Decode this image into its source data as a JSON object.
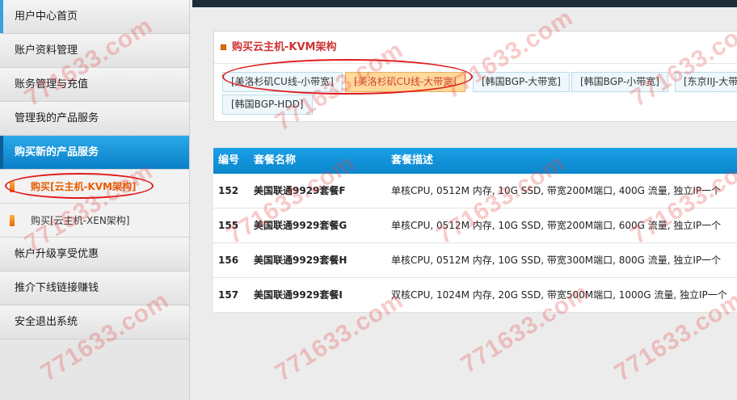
{
  "sidebar": {
    "items": [
      {
        "label": "用户中心首页"
      },
      {
        "label": "账户资料管理"
      },
      {
        "label": "账务管理与充值"
      },
      {
        "label": "管理我的产品服务"
      },
      {
        "label": "购买新的产品服务"
      }
    ],
    "sub_items": [
      {
        "label": "购买[云主机-KVM架构]"
      },
      {
        "label": "购买[云主机-XEN架构]"
      }
    ],
    "bottom_items": [
      {
        "label": "帐户升级享受优惠"
      },
      {
        "label": "推介下线链接赚钱"
      },
      {
        "label": "安全退出系统"
      }
    ]
  },
  "panel": {
    "title": "购买云主机-KVM架构",
    "tabs": [
      "[美洛杉矶CU线-小带宽]",
      "[美洛杉矶CU线-大带宽]",
      "[韩国BGP-大带宽]",
      "[韩国BGP-小带宽]",
      "[东京IIJ-大带",
      "[韩国BGP-HDD]"
    ]
  },
  "table": {
    "headers": [
      "编号",
      "套餐名称",
      "套餐描述"
    ],
    "rows": [
      {
        "id": "152",
        "name": "美国联通9929套餐F",
        "desc": "单核CPU, 0512M 内存, 10G SSD, 带宽200M端口, 400G 流量, 独立IP一个"
      },
      {
        "id": "155",
        "name": "美国联通9929套餐G",
        "desc": "单核CPU, 0512M 内存, 10G SSD, 带宽200M端口, 600G 流量, 独立IP一个"
      },
      {
        "id": "156",
        "name": "美国联通9929套餐H",
        "desc": "单核CPU, 0512M 内存, 10G SSD, 带宽300M端口, 800G 流量, 独立IP一个"
      },
      {
        "id": "157",
        "name": "美国联通9929套餐I",
        "desc": "双核CPU, 1024M 内存, 20G SSD, 带宽500M端口, 1000G 流量, 独立IP一个"
      }
    ]
  },
  "watermark": "771633.com",
  "colors": {
    "accent_blue": "#0b86cc",
    "highlight_red": "#e11a1a",
    "active_tab": "#ffd89a"
  }
}
